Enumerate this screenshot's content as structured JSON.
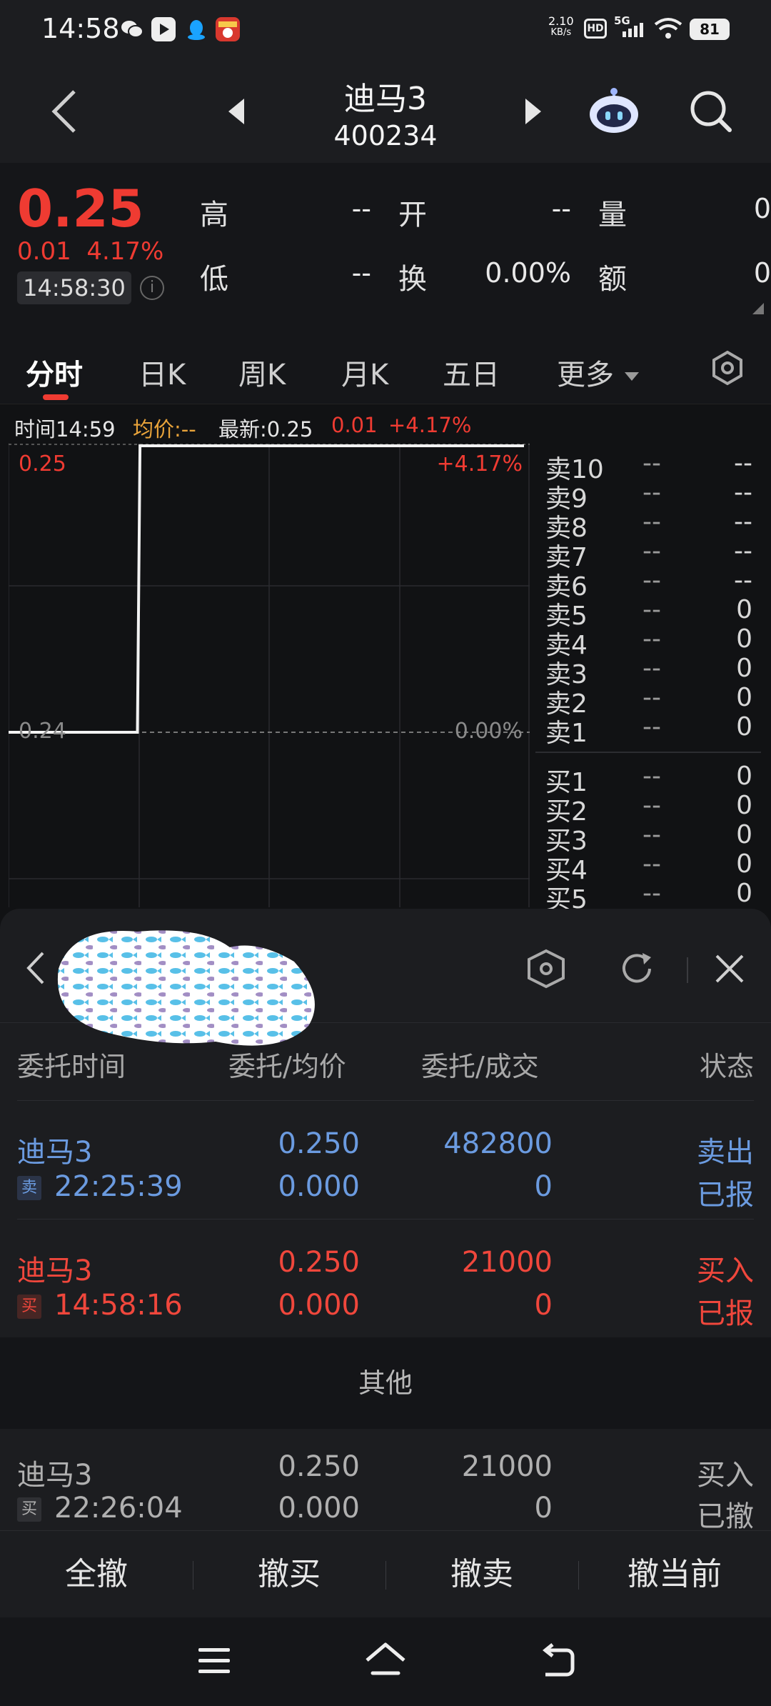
{
  "status_bar": {
    "time": "14:58",
    "net_speed": "2.10",
    "net_unit": "KB/s",
    "hd": "HD",
    "signal": "5G",
    "battery": "81"
  },
  "header": {
    "title": "迪马3",
    "code": "400234"
  },
  "quote": {
    "price": "0.25",
    "change": "0.01",
    "change_pct": "4.17%",
    "time": "14:58:30",
    "info": "i",
    "high_label": "高",
    "high": "--",
    "open_label": "开",
    "open": "--",
    "vol_label": "量",
    "vol": "0",
    "low_label": "低",
    "low": "--",
    "turnover_label": "换",
    "turnover": "0.00%",
    "amount_label": "额",
    "amount": "0"
  },
  "tabs": {
    "fenshi": "分时",
    "day": "日K",
    "week": "周K",
    "month": "月K",
    "five": "五日",
    "more": "更多"
  },
  "chart_info": {
    "time_label": "时间",
    "time": "14:59",
    "avg_label": "均价:",
    "avg": "--",
    "latest_label": "最新:",
    "latest": "0.25",
    "change": "0.01",
    "pct": "+4.17%"
  },
  "chart_data": {
    "type": "line",
    "y_top_label": "0.25",
    "y_top_pct": "+4.17%",
    "y_base_label": "0.24",
    "y_base_pct": "0.00%",
    "ylim": [
      0.24,
      0.25
    ],
    "series": [
      {
        "values": [
          0.24,
          0.24,
          0.25,
          0.25
        ]
      }
    ],
    "x_fraction": [
      0,
      0.25,
      0.255,
      1
    ],
    "grid": true
  },
  "orderbook": {
    "asks": [
      {
        "label": "卖10",
        "price": "--",
        "vol": "--"
      },
      {
        "label": "卖9",
        "price": "--",
        "vol": "--"
      },
      {
        "label": "卖8",
        "price": "--",
        "vol": "--"
      },
      {
        "label": "卖7",
        "price": "--",
        "vol": "--"
      },
      {
        "label": "卖6",
        "price": "--",
        "vol": "--"
      },
      {
        "label": "卖5",
        "price": "--",
        "vol": "0"
      },
      {
        "label": "卖4",
        "price": "--",
        "vol": "0"
      },
      {
        "label": "卖3",
        "price": "--",
        "vol": "0"
      },
      {
        "label": "卖2",
        "price": "--",
        "vol": "0"
      },
      {
        "label": "卖1",
        "price": "--",
        "vol": "0"
      }
    ],
    "bids": [
      {
        "label": "买1",
        "price": "--",
        "vol": "0"
      },
      {
        "label": "买2",
        "price": "--",
        "vol": "0"
      },
      {
        "label": "买3",
        "price": "--",
        "vol": "0"
      },
      {
        "label": "买4",
        "price": "--",
        "vol": "0"
      },
      {
        "label": "买5",
        "price": "--",
        "vol": "0"
      }
    ]
  },
  "orders": {
    "col_time": "委托时间",
    "col_price": "委托/均价",
    "col_qty": "委托/成交",
    "col_status": "状态",
    "rows": [
      {
        "name": "迪马3",
        "tag": "卖",
        "time": "22:25:39",
        "price": "0.250",
        "avg": "0.000",
        "qty": "482800",
        "filled": "0",
        "status1": "卖出",
        "status2": "已报"
      },
      {
        "name": "迪马3",
        "tag": "买",
        "time": "14:58:16",
        "price": "0.250",
        "avg": "0.000",
        "qty": "21000",
        "filled": "0",
        "status1": "买入",
        "status2": "已报"
      }
    ],
    "other_label": "其他",
    "other_rows": [
      {
        "name": "迪马3",
        "tag": "买",
        "time": "22:26:04",
        "price": "0.250",
        "avg": "0.000",
        "qty": "21000",
        "filled": "0",
        "status1": "买入",
        "status2": "已撤"
      }
    ]
  },
  "actions": {
    "cancel_all": "全撤",
    "cancel_buy": "撤买",
    "cancel_sell": "撤卖",
    "cancel_current": "撤当前"
  },
  "colors": {
    "up": "#ef3b32",
    "blue": "#6b9be0",
    "avg": "#e8a33a"
  }
}
